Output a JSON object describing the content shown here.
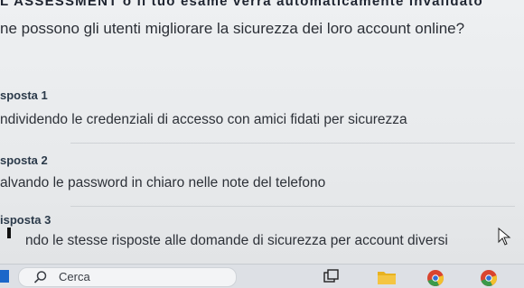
{
  "banner": "L'ASSESSMENT o il tuo esame verrà automaticamente invalidato",
  "question": "ne possono gli utenti migliorare la sicurezza dei loro account online?",
  "answers": [
    {
      "title": "sposta 1",
      "text": "ndividendo le credenziali di accesso con amici fidati per sicurezza"
    },
    {
      "title": "sposta 2",
      "text": "alvando le password in chiaro nelle note del telefono"
    },
    {
      "title": "isposta 3",
      "text": "ndo le stesse risposte alle domande di sicurezza per account diversi"
    }
  ],
  "taskbar": {
    "search_placeholder": "Cerca",
    "icons": [
      "windows-logo",
      "search-icon",
      "task-view-icon",
      "file-explorer-icon",
      "chrome-icon",
      "chrome-profile-icon"
    ]
  },
  "colors": {
    "taskbar": "#dde0e5",
    "windows_blue": "#1b66c9",
    "folder_yellow": "#e8b220",
    "chrome_red": "#d9452f",
    "chrome_blue": "#2f6fd6"
  }
}
